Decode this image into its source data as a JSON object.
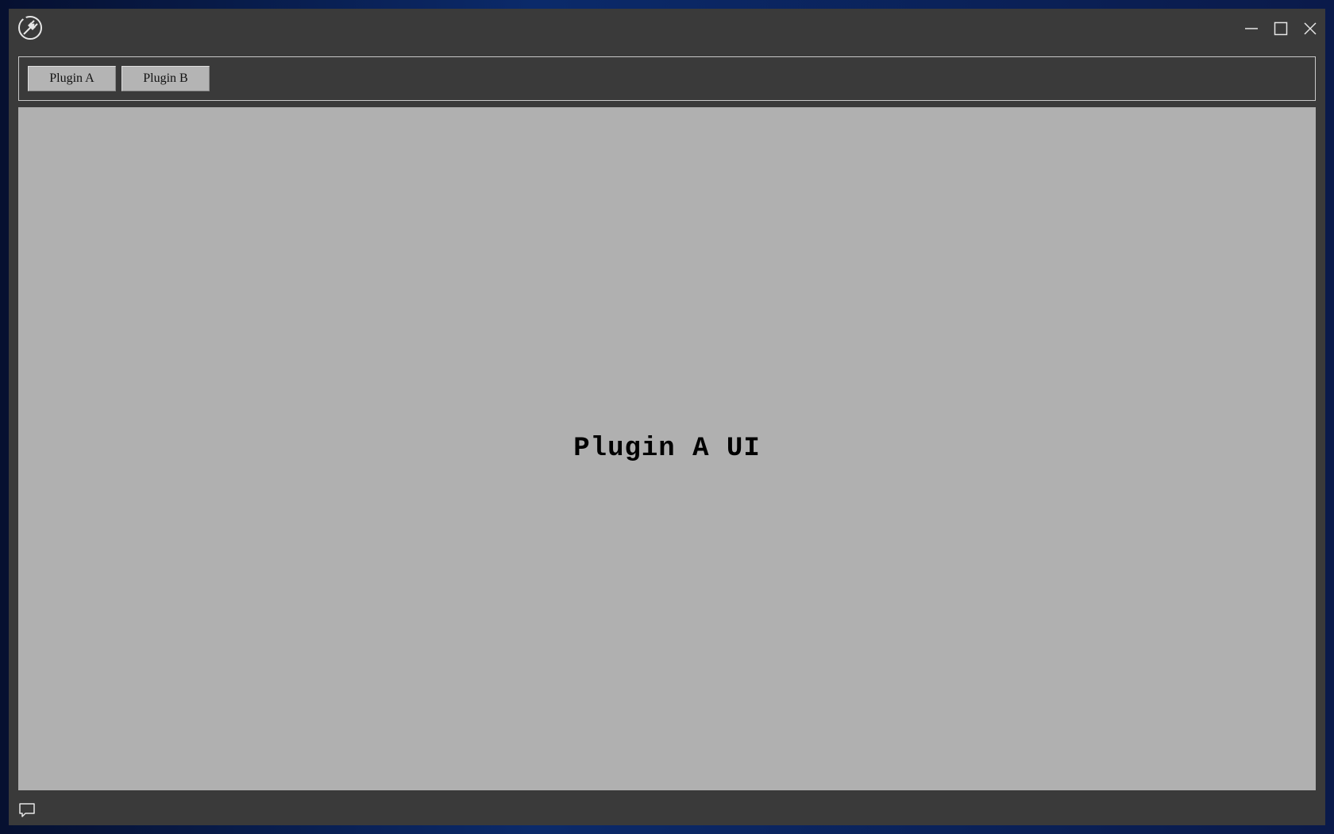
{
  "window": {
    "app_icon": "plug-icon",
    "controls": {
      "minimize_icon": "minimize-icon",
      "maximize_icon": "maximize-icon",
      "close_icon": "close-icon"
    }
  },
  "toolbar": {
    "tabs": [
      {
        "label": "Plugin A"
      },
      {
        "label": "Plugin B"
      }
    ]
  },
  "main": {
    "content_title": "Plugin A UI"
  },
  "statusbar": {
    "icon": "message-icon"
  },
  "colors": {
    "window_bg": "#3a3a3a",
    "content_bg": "#b0b0b0",
    "button_bg": "#b4b4b4"
  }
}
